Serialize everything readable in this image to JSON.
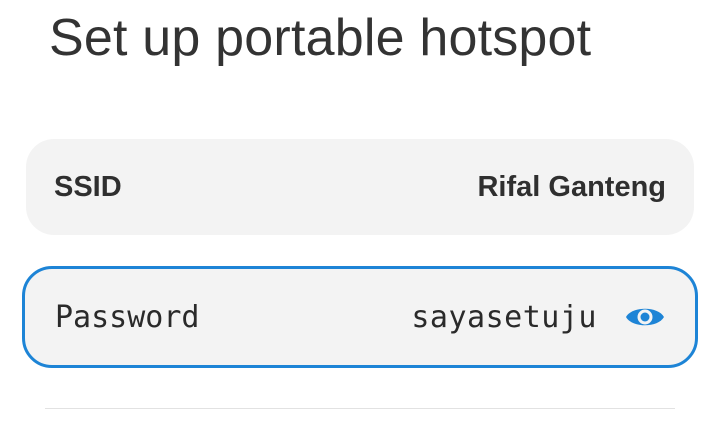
{
  "page": {
    "title": "Set up portable hotspot"
  },
  "ssid": {
    "label": "SSID",
    "value": "Rifal Ganteng"
  },
  "password": {
    "label": "Password",
    "value": "sayasetuju",
    "visibility_icon": "eye-icon"
  },
  "colors": {
    "accent": "#1d84d6",
    "field_background": "#f3f3f3",
    "text": "#2f2f2f"
  }
}
